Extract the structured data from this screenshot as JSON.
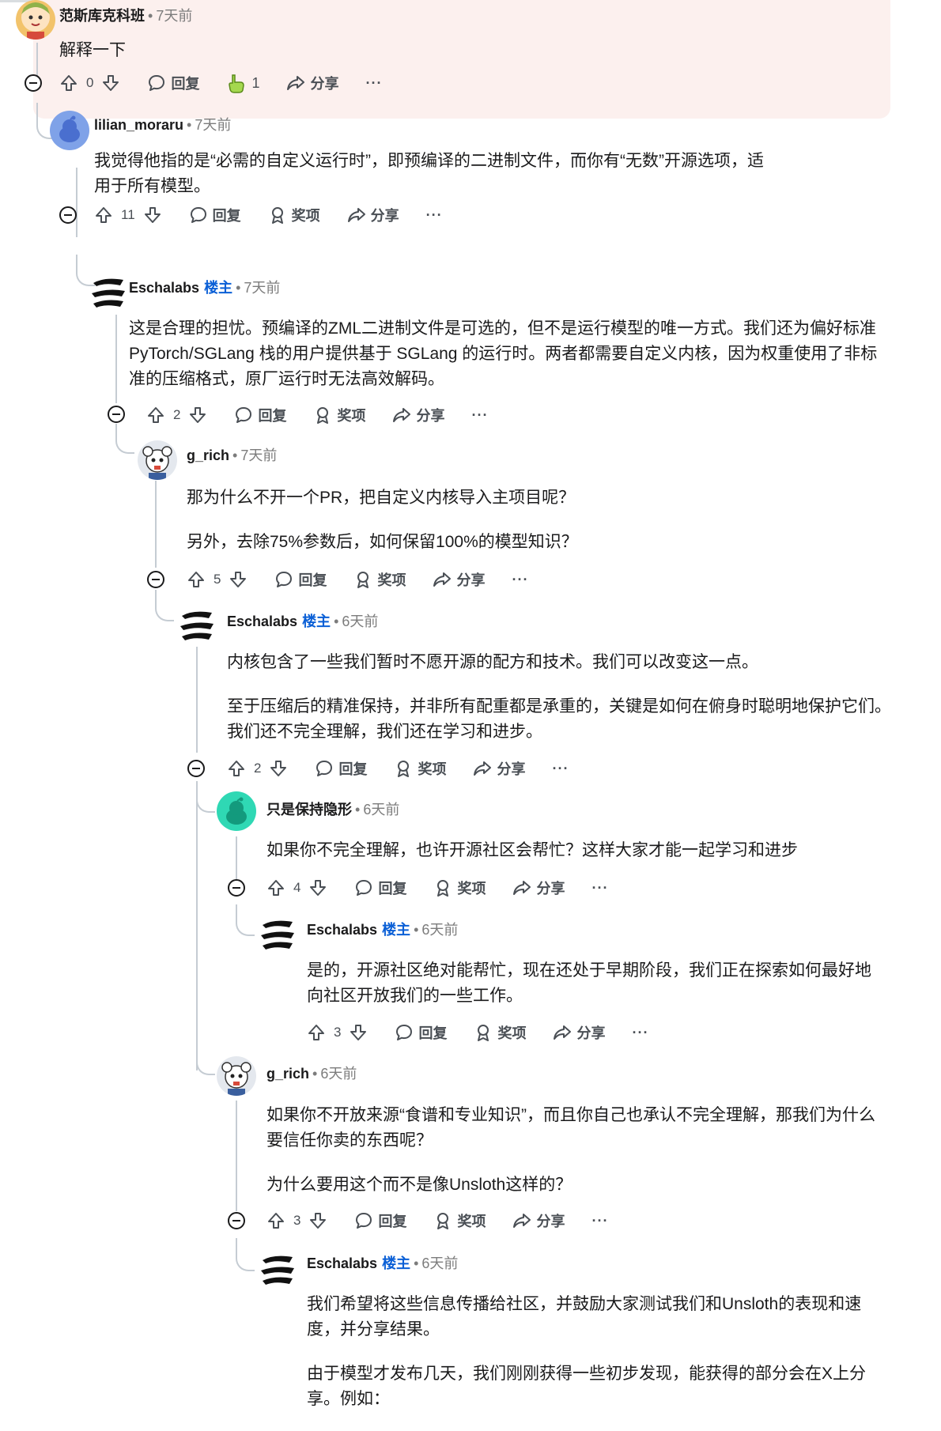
{
  "colors": {
    "op_badge": "#0a5fd6",
    "thread_line": "#c5ccd3",
    "highlight_bg": "#fcf0ee",
    "meta_gray": "#7c7c7c"
  },
  "actions_labels": {
    "reply": "回复",
    "award": "奖项",
    "share": "分享",
    "more": "···"
  },
  "comments": [
    {
      "author": "范斯库克科班",
      "op_badge": "",
      "time": "7天前",
      "paragraphs": [
        "解释一下"
      ],
      "upvotes": "0",
      "reaction_count": "1",
      "avatar_icon": "cartoon-avatar-icon"
    },
    {
      "author": "lilian_moraru",
      "op_badge": "",
      "time": "7天前",
      "paragraphs": [
        "我觉得他指的是“必需的自定义运行时”，即预编译的二进制文件，而你有“无数”开源选项，适用于所有模型。"
      ],
      "upvotes": "11",
      "avatar_icon": "default-snoo-avatar-icon"
    },
    {
      "author": "Eschalabs",
      "op_badge": "楼主",
      "time": "7天前",
      "paragraphs": [
        "这是合理的担忧。预编译的ZML二进制文件是可选的，但不是运行模型的唯一方式。我们还为偏好标准 PyTorch/SGLang 栈的用户提供基于 SGLang 的运行时。两者都需要自定义内核，因为权重使用了非标准的压缩格式，原厂运行时无法高效解码。"
      ],
      "upvotes": "2",
      "avatar_icon": "eschalabs-logo-icon"
    },
    {
      "author": "g_rich",
      "op_badge": "",
      "time": "7天前",
      "paragraphs": [
        "那为什么不开一个PR，把自定义内核导入主项目呢？",
        "另外，去除75%参数后，如何保留100%的模型知识？"
      ],
      "upvotes": "5",
      "avatar_icon": "snoo-avatar-icon"
    },
    {
      "author": "Eschalabs",
      "op_badge": "楼主",
      "time": "6天前",
      "paragraphs": [
        "内核包含了一些我们暂时不愿开源的配方和技术。我们可以改变这一点。",
        "至于压缩后的精准保持，并非所有配重都是承重的，关键是如何在俯身时聪明地保护它们。我们还不完全理解，我们还在学习和进步。"
      ],
      "upvotes": "2",
      "avatar_icon": "eschalabs-logo-icon"
    },
    {
      "author": "只是保持隐形",
      "op_badge": "",
      "time": "6天前",
      "paragraphs": [
        "如果你不完全理解，也许开源社区会帮忙？这样大家才能一起学习和进步"
      ],
      "upvotes": "4",
      "avatar_icon": "default-snoo-avatar-icon"
    },
    {
      "author": "Eschalabs",
      "op_badge": "楼主",
      "time": "6天前",
      "paragraphs": [
        "是的，开源社区绝对能帮忙，现在还处于早期阶段，我们正在探索如何最好地向社区开放我们的一些工作。"
      ],
      "upvotes": "3",
      "avatar_icon": "eschalabs-logo-icon"
    },
    {
      "author": "g_rich",
      "op_badge": "",
      "time": "6天前",
      "paragraphs": [
        "如果你不开放来源“食谱和专业知识”，而且你自己也承认不完全理解，那我们为什么要信任你卖的东西呢？",
        "为什么要用这个而不是像Unsloth这样的？"
      ],
      "upvotes": "3",
      "avatar_icon": "snoo-avatar-icon"
    },
    {
      "author": "Eschalabs",
      "op_badge": "楼主",
      "time": "6天前",
      "paragraphs": [
        "我们希望将这些信息传播给社区，并鼓励大家测试我们和Unsloth的表现和速度，并分享结果。",
        "由于模型才发布几天，我们刚刚获得一些初步发现，能获得的部分会在X上分享。例如："
      ],
      "upvotes": "",
      "avatar_icon": "eschalabs-logo-icon"
    }
  ]
}
